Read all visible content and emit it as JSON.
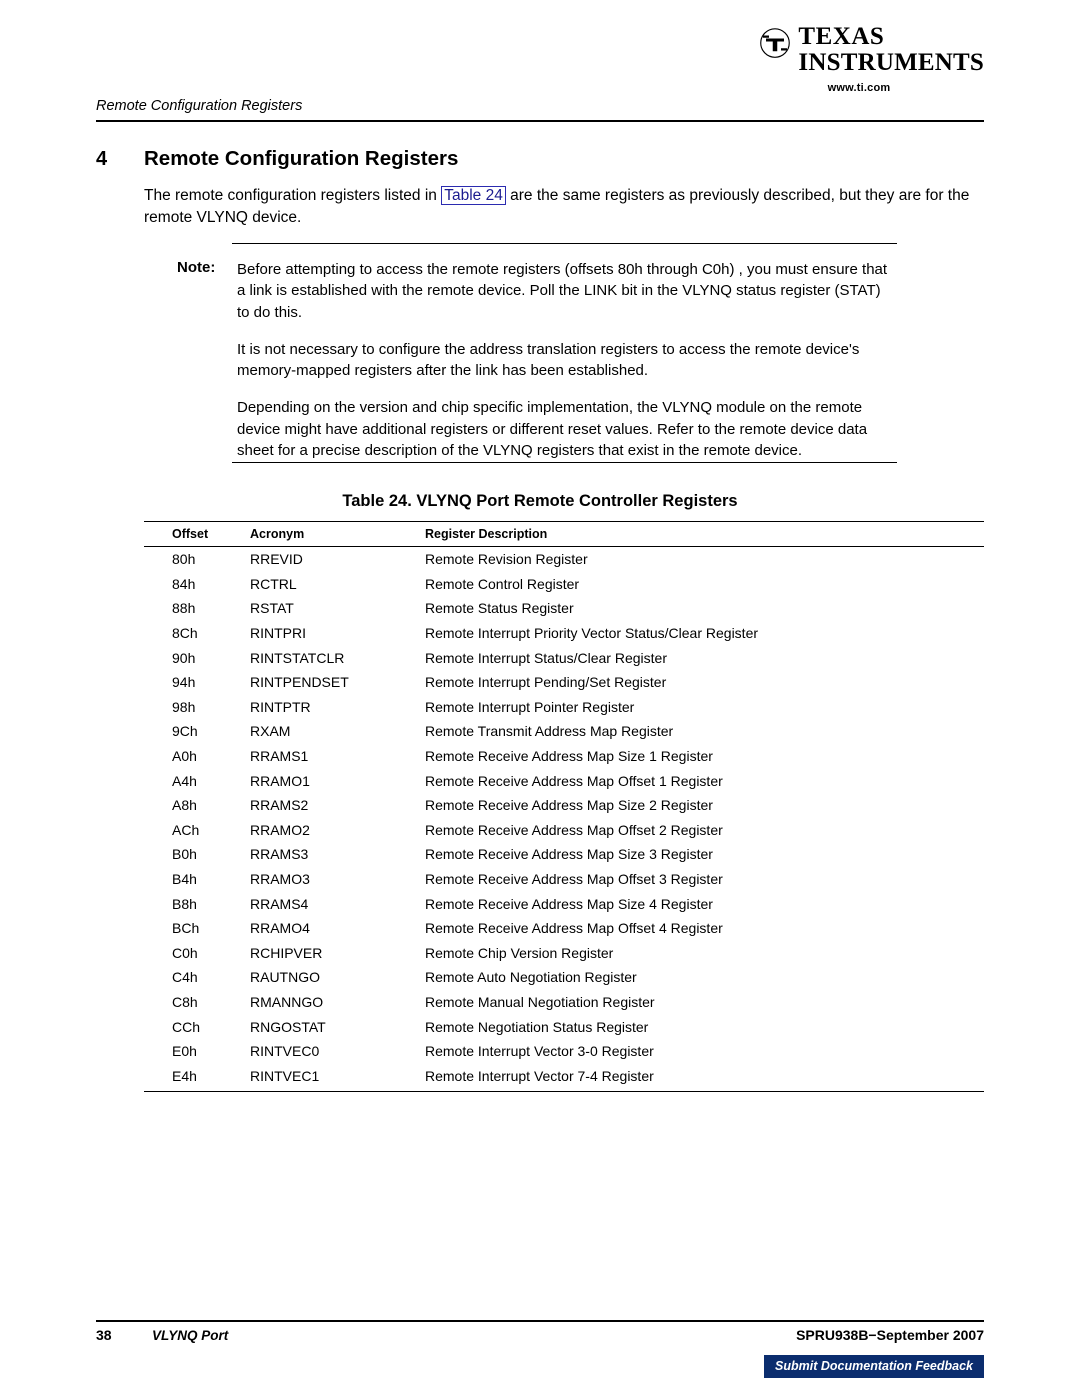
{
  "header": {
    "logo_texas": "TEXAS",
    "logo_instruments": "INSTRUMENTS",
    "logo_url": "www.ti.com",
    "running_head": "Remote Configuration Registers"
  },
  "section": {
    "number": "4",
    "title": "Remote Configuration Registers",
    "intro_part1": "The remote configuration registers listed in ",
    "intro_xref": "Table 24",
    "intro_part2": " are the same registers as previously described, but they are for the remote VLYNQ device."
  },
  "note": {
    "label": "Note:",
    "paragraphs": [
      "Before attempting to access the remote registers (offsets 80h through C0h) , you must ensure that a link is established with the remote device. Poll the LINK bit in the VLYNQ status register (STAT) to do this.",
      "It is not necessary to configure the address translation registers to access the remote device's memory-mapped registers after the link has been established.",
      "Depending on the version and chip specific implementation, the VLYNQ module on the remote device might have additional registers or different reset values. Refer to the remote device data sheet for a precise description of the VLYNQ registers that exist in the remote device."
    ]
  },
  "table": {
    "caption": "Table 24. VLYNQ Port Remote Controller Registers",
    "columns": [
      "Offset",
      "Acronym",
      "Register Description"
    ],
    "rows": [
      [
        "80h",
        "RREVID",
        "Remote Revision Register"
      ],
      [
        "84h",
        "RCTRL",
        "Remote Control Register"
      ],
      [
        "88h",
        "RSTAT",
        "Remote Status Register"
      ],
      [
        "8Ch",
        "RINTPRI",
        "Remote Interrupt Priority Vector Status/Clear Register"
      ],
      [
        "90h",
        "RINTSTATCLR",
        "Remote Interrupt Status/Clear Register"
      ],
      [
        "94h",
        "RINTPENDSET",
        "Remote Interrupt Pending/Set Register"
      ],
      [
        "98h",
        "RINTPTR",
        "Remote Interrupt Pointer Register"
      ],
      [
        "9Ch",
        "RXAM",
        "Remote Transmit Address Map Register"
      ],
      [
        "A0h",
        "RRAMS1",
        "Remote Receive Address Map Size 1 Register"
      ],
      [
        "A4h",
        "RRAMO1",
        "Remote Receive Address Map Offset 1 Register"
      ],
      [
        "A8h",
        "RRAMS2",
        "Remote Receive Address Map Size 2 Register"
      ],
      [
        "ACh",
        "RRAMO2",
        "Remote Receive Address Map Offset 2 Register"
      ],
      [
        "B0h",
        "RRAMS3",
        "Remote Receive Address Map Size 3 Register"
      ],
      [
        "B4h",
        "RRAMO3",
        "Remote Receive Address Map Offset 3 Register"
      ],
      [
        "B8h",
        "RRAMS4",
        "Remote Receive Address Map Size 4 Register"
      ],
      [
        "BCh",
        "RRAMO4",
        "Remote Receive Address Map Offset 4 Register"
      ],
      [
        "C0h",
        "RCHIPVER",
        "Remote Chip Version Register"
      ],
      [
        "C4h",
        "RAUTNGO",
        "Remote Auto Negotiation Register"
      ],
      [
        "C8h",
        "RMANNGO",
        "Remote Manual Negotiation Register"
      ],
      [
        "CCh",
        "RNGOSTAT",
        "Remote Negotiation Status Register"
      ],
      [
        "E0h",
        "RINTVEC0",
        "Remote Interrupt Vector 3-0 Register"
      ],
      [
        "E4h",
        "RINTVEC1",
        "Remote Interrupt Vector 7-4 Register"
      ]
    ]
  },
  "footer": {
    "page_number": "38",
    "doc_title": "VLYNQ Port",
    "doc_id": "SPRU938B−September 2007",
    "feedback": "Submit Documentation Feedback",
    "feedback_color": "#0b2d6e"
  }
}
